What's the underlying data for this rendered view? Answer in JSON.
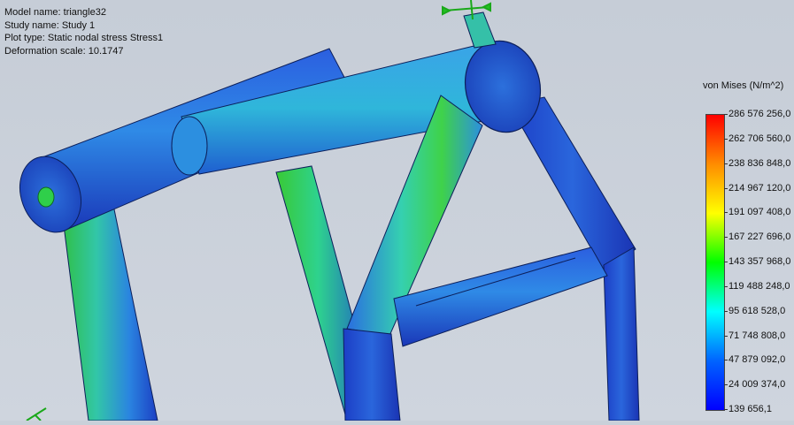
{
  "info": {
    "model": "Model name: triangle32",
    "study": "Study name: Study 1",
    "plot_type": "Plot type: Static nodal stress Stress1",
    "deformation": "Deformation scale: 10.1747"
  },
  "legend": {
    "title": "von Mises (N/m^2)",
    "labels": [
      "286 576 256,0",
      "262 706 560,0",
      "238 836 848,0",
      "214 967 120,0",
      "191 097 408,0",
      "167 227 696,0",
      "143 357 968,0",
      "119 488 248,0",
      "95 618 528,0",
      "71 748 808,0",
      "47 879 092,0",
      "24 009 374,0",
      "139 656,1"
    ],
    "gradient_colors": [
      "#ff0000",
      "#ff8c00",
      "#ffff00",
      "#00ff00",
      "#00ffff",
      "#0064ff",
      "#0000ff"
    ]
  },
  "colors": {
    "deep_blue": "#1f3fc8",
    "mid_blue": "#2b6ee0",
    "cyan": "#2ec9d6",
    "green": "#2fcf4a",
    "background": "#c9d0d9"
  }
}
